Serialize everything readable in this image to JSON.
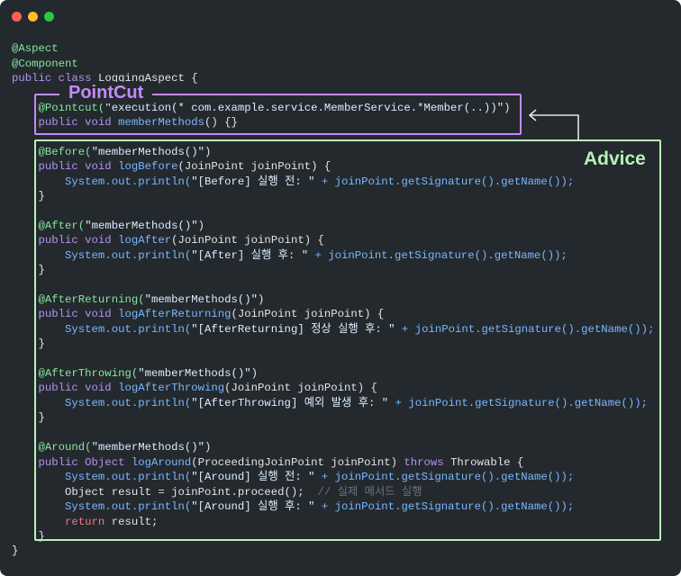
{
  "window": {
    "controls": [
      "close",
      "minimize",
      "maximize"
    ]
  },
  "labels": {
    "pointcut": "PointCut",
    "advice": "Advice"
  },
  "code": {
    "l1": "@Aspect",
    "l2": "@Component",
    "l3a": "public class ",
    "l3b": "LoggingAspect {",
    "l4a": "    @Pointcut(",
    "l4b": "\"execution(* com.example.service.MemberService.*Member(..))\"",
    "l4c": ")",
    "l5a": "    public void ",
    "l5b": "memberMethods",
    "l5c": "() {}",
    "l6a": "    @Before(",
    "l6b": "\"memberMethods()\"",
    "l6c": ")",
    "l7a": "    public void ",
    "l7b": "logBefore",
    "l7c": "(JoinPoint joinPoint) {",
    "l8a": "        System.out.println(",
    "l8b": "\"[Before] 실행 전: \"",
    "l8c": " + joinPoint.getSignature().getName());",
    "l9": "    }",
    "l10a": "    @After(",
    "l10b": "\"memberMethods()\"",
    "l10c": ")",
    "l11a": "    public void ",
    "l11b": "logAfter",
    "l11c": "(JoinPoint joinPoint) {",
    "l12a": "        System.out.println(",
    "l12b": "\"[After] 실행 후: \"",
    "l12c": " + joinPoint.getSignature().getName());",
    "l13": "    }",
    "l14a": "    @AfterReturning(",
    "l14b": "\"memberMethods()\"",
    "l14c": ")",
    "l15a": "    public void ",
    "l15b": "logAfterReturning",
    "l15c": "(JoinPoint joinPoint) {",
    "l16a": "        System.out.println(",
    "l16b": "\"[AfterReturning] 정상 실행 후: \"",
    "l16c": " + joinPoint.getSignature().getName());",
    "l17": "    }",
    "l18a": "    @AfterThrowing(",
    "l18b": "\"memberMethods()\"",
    "l18c": ")",
    "l19a": "    public void ",
    "l19b": "logAfterThrowing",
    "l19c": "(JoinPoint joinPoint) {",
    "l20a": "        System.out.println(",
    "l20b": "\"[AfterThrowing] 예외 발생 후: \"",
    "l20c": " + joinPoint.getSignature().getName());",
    "l21": "    }",
    "l22a": "    @Around(",
    "l22b": "\"memberMethods()\"",
    "l22c": ")",
    "l23a": "    public Object ",
    "l23b": "logAround",
    "l23c": "(ProceedingJoinPoint joinPoint) ",
    "l23d": "throws ",
    "l23e": "Throwable {",
    "l24a": "        System.out.println(",
    "l24b": "\"[Around] 실행 전: \"",
    "l24c": " + joinPoint.getSignature().getName());",
    "l25a": "        Object result = joinPoint.proceed();  ",
    "l25b": "// 실제 메서드 실행",
    "l26a": "        System.out.println(",
    "l26b": "\"[Around] 실행 후: \"",
    "l26c": " + joinPoint.getSignature().getName());",
    "l27a": "        return ",
    "l27b": "result;",
    "l28": "    }",
    "l29": "}"
  }
}
